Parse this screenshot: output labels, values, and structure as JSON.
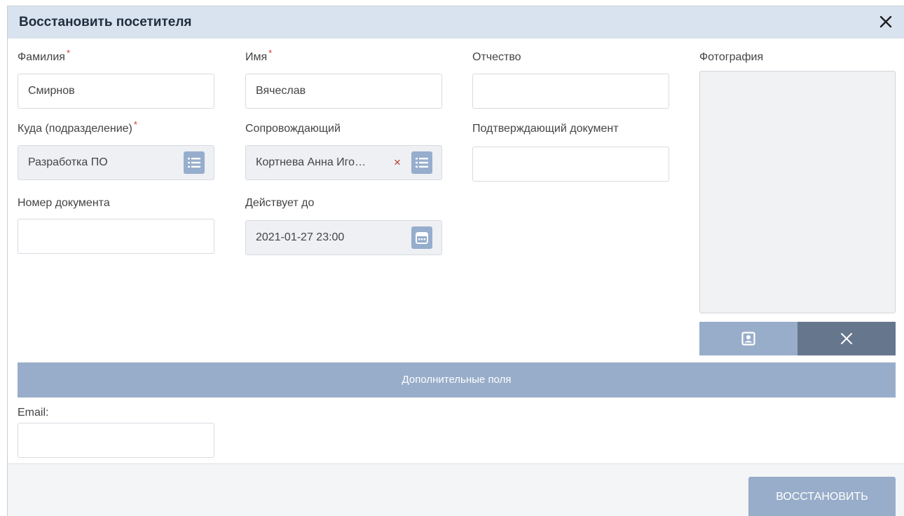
{
  "dialog": {
    "title": "Восстановить посетителя",
    "close_icon": "close-icon"
  },
  "fields": {
    "last_name": {
      "label": "Фамилия",
      "required_mark": "*",
      "value": "Смирнов"
    },
    "first_name": {
      "label": "Имя",
      "required_mark": "*",
      "value": "Вячеслав"
    },
    "patronymic": {
      "label": "Отчество",
      "value": ""
    },
    "department": {
      "label": "Куда (подразделение)",
      "required_mark": "*",
      "value": "Разработка ПО",
      "icon": "list-icon"
    },
    "escort": {
      "label": "Сопровождающий",
      "value": "Кортнева Анна Иго…",
      "clear_symbol": "×",
      "icon": "list-icon"
    },
    "confirm_doc": {
      "label": "Подтверждающий документ",
      "value": ""
    },
    "doc_number": {
      "label": "Номер документа",
      "value": ""
    },
    "valid_until": {
      "label": "Действует до",
      "value": "2021-01-27 23:00",
      "icon": "calendar-icon"
    },
    "email": {
      "label": "Email:",
      "value": ""
    }
  },
  "photo": {
    "label": "Фотография",
    "select_icon": "portrait-icon",
    "remove_icon": "close-icon"
  },
  "extra_fields_label": "Дополнительные поля",
  "footer": {
    "restore_label": "ВОССТАНОВИТЬ"
  },
  "colors": {
    "header_bg": "#d9e3ef",
    "accent": "#98adc9",
    "dark_button": "#66768d",
    "required": "#d9362b"
  }
}
